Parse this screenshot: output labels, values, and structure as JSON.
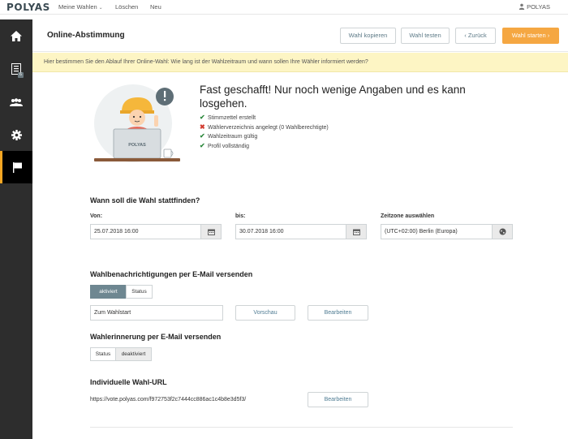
{
  "topnav": {
    "logo": "POLYAS",
    "items": [
      {
        "label": "Meine Wahlen",
        "caret": "⌄"
      },
      {
        "label": "Löschen"
      },
      {
        "label": "Neu"
      }
    ],
    "user": "POLYAS"
  },
  "sidebar": {
    "items": [
      {
        "name": "home",
        "icon": "home-icon"
      },
      {
        "name": "ballot",
        "icon": "list-icon",
        "badge": "6"
      },
      {
        "name": "voters",
        "icon": "users-icon"
      },
      {
        "name": "settings",
        "icon": "gear-icon"
      },
      {
        "name": "start",
        "icon": "flag-icon",
        "active": true
      }
    ]
  },
  "header": {
    "title": "Online-Abstimmung",
    "btn_copy": "Wahl kopieren",
    "btn_test": "Wahl testen",
    "btn_back": "‹ Zurück",
    "btn_start": "Wahl starten ›"
  },
  "infobar": {
    "text": "Hier bestimmen Sie den Ablauf Ihrer Online-Wahl: Wie lang ist der Wahlzeitraum und wann sollen Ihre Wähler informiert werden?"
  },
  "hero": {
    "title": "Fast geschafft! Nur noch wenige Angaben und es kann losgehen.",
    "laptop_label": "POLYAS",
    "checklist": [
      {
        "mark": "✔",
        "status": "ok",
        "text": "Stimmzettel erstellt"
      },
      {
        "mark": "✖",
        "status": "error",
        "text": "Wählerverzeichnis angelegt (0 Wahlberechtigte)"
      },
      {
        "mark": "✔",
        "status": "ok",
        "text": "Wahlzeitraum gültig"
      },
      {
        "mark": "✔",
        "status": "ok",
        "text": "Profil vollständig"
      }
    ]
  },
  "schedule": {
    "title": "Wann soll die Wahl stattfinden?",
    "from_label": "Von:",
    "from_value": "25.07.2018 16:00",
    "to_label": "bis:",
    "to_value": "30.07.2018 16:00",
    "tz_label": "Zeitzone auswählen",
    "tz_value": "(UTC+02:00) Berlin (Europa)"
  },
  "notifications": {
    "title": "Wahlbenachrichtigungen per E-Mail versenden",
    "toggle_on": "aktiviert",
    "toggle_status": "Status",
    "select_value": "Zum Wahlstart",
    "preview_btn": "Vorschau",
    "edit_btn": "Bearbeiten"
  },
  "reminder": {
    "title": "Wahlerinnerung per E-Mail versenden",
    "toggle_status": "Status",
    "toggle_off": "deaktiviert"
  },
  "url_section": {
    "title": "Individuelle Wahl-URL",
    "url": "https://vote.polyas.com/f972753f2c7444cc886ac1c4b8e3d5f3/",
    "edit_btn": "Bearbeiten"
  },
  "colors": {
    "accent": "#f5a742",
    "sidebar": "#2d2d2d",
    "info_bg": "#fdf5c4",
    "ok": "#2f8a3f",
    "error": "#d23b2f",
    "toggle_active": "#6e8791"
  }
}
